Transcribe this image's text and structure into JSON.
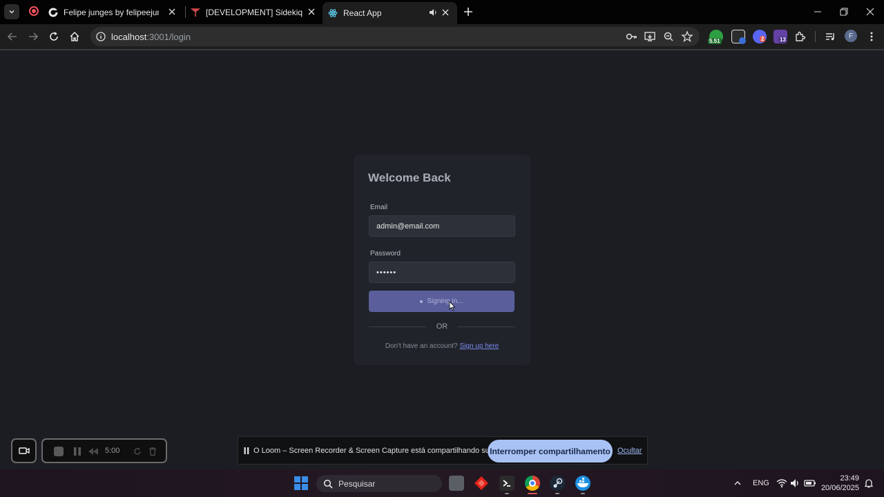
{
  "browser": {
    "tabs": [
      {
        "title": "Felipe junges by felipeejunges",
        "active": false
      },
      {
        "title": "[DEVELOPMENT] Sidekiq",
        "active": false
      },
      {
        "title": "React App",
        "active": true
      }
    ],
    "url_host": "localhost",
    "url_rest": ":3001/login",
    "extensions": [
      {
        "name": "ext-score-icon",
        "badge": "5.51",
        "color": "#2ea043"
      },
      {
        "name": "ext-window-icon",
        "badge": "",
        "color": "#3b6fd8"
      },
      {
        "name": "ext-discord-icon",
        "badge": "2",
        "color": "#5865f2"
      },
      {
        "name": "ext-twitch-icon",
        "badge": "13",
        "color": "#6441a5"
      }
    ],
    "profile_initial": "F"
  },
  "login": {
    "title": "Welcome Back",
    "email_label": "Email",
    "email_value": "admin@email.com",
    "password_label": "Password",
    "password_value": "••••••",
    "submit_label": "Signing in...",
    "or_text": "OR",
    "signup_prompt": "Don't have an account?",
    "signup_link": "Sign up here"
  },
  "loom": {
    "timer": "5:00",
    "share_message": "O Loom – Screen Recorder & Screen Capture está compartilhando sua tela.",
    "stop_sharing": "Interromper compartilhamento",
    "hide": "Ocultar"
  },
  "taskbar": {
    "search_placeholder": "Pesquisar",
    "language": "ENG",
    "time": "23:49",
    "date": "20/06/2025"
  }
}
